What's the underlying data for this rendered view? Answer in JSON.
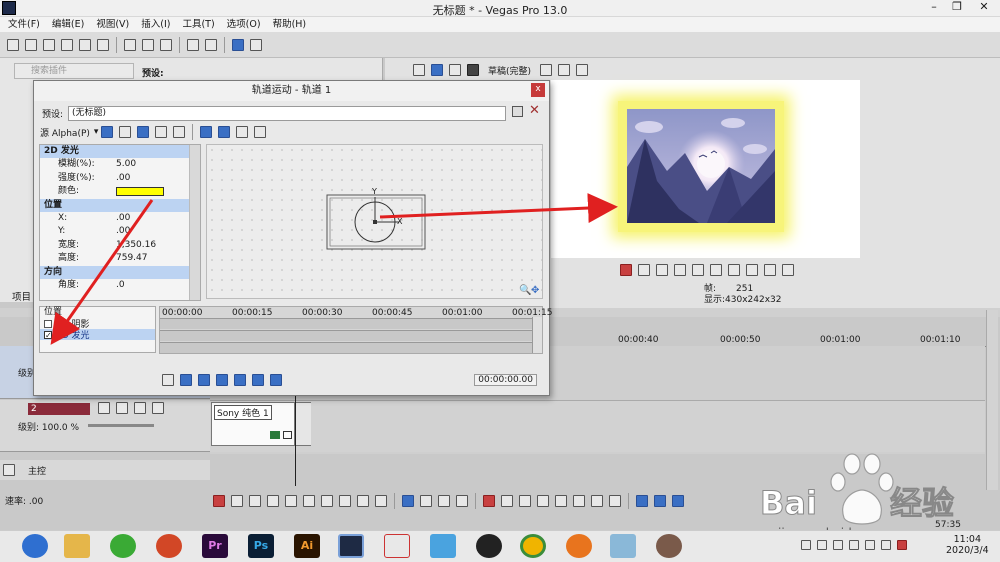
{
  "window": {
    "title": "无标题 * - Vegas Pro 13.0",
    "minimize": "–",
    "restore": "❐",
    "close": "✕"
  },
  "menu": [
    "文件(F)",
    "编辑(E)",
    "视图(V)",
    "插入(I)",
    "工具(T)",
    "选项(O)",
    "帮助(H)"
  ],
  "explorer": {
    "search_placeholder": "搜索插件",
    "preset_label": "预设:",
    "tab_label": "项目"
  },
  "preview": {
    "quality": "草稿(完整)",
    "frame_label": "帧:",
    "frame_value": "251",
    "display_label": "显示:",
    "display_value": "430x242x32"
  },
  "dialog": {
    "title": "轨道运动 - 轨道 1",
    "close": "x",
    "preset_label": "预设:",
    "preset_value": "(无标题)",
    "source_alpha": "源 Alpha(P)",
    "sections": {
      "glow": "2D 发光",
      "position": "位置",
      "orientation": "方向"
    },
    "params": {
      "blur_label": "模糊(%):",
      "blur_value": "5.00",
      "intensity_label": "强度(%):",
      "intensity_value": ".00",
      "color_label": "颜色:",
      "x_label": "X:",
      "x_value": ".00",
      "y_label": "Y:",
      "y_value": ".00",
      "width_label": "宽度:",
      "width_value": "1,350.16",
      "height_label": "高度:",
      "height_value": "759.47",
      "angle_label": "角度:",
      "angle_value": ".0"
    },
    "glow_color": "#ffff00",
    "timeline": {
      "ticks": [
        "00:00:00",
        "00:00:15",
        "00:00:30",
        "00:00:45",
        "00:01:00",
        "00:01:15"
      ],
      "list_header": "位置",
      "shadow_item": "2D 阴影",
      "glow_item": "2D 发光",
      "timecode": "00:00:00.00"
    },
    "canvas": {
      "y_axis": "Y",
      "x_axis": "X"
    }
  },
  "tracks": {
    "ruler": [
      "00:00:40",
      "00:00:50",
      "00:01:00",
      "00:01:10"
    ],
    "track1_level": "级别",
    "track2_number": "2",
    "track2_level": "级别: 100.0 %",
    "event_label": "Sony 纯色 1",
    "master_label": "主控",
    "rate": "速率: .00",
    "timecode": "57:35"
  },
  "watermark": {
    "text": "jingyan.baidu.com"
  },
  "taskbar": {
    "apps": [
      "Pr",
      "Ps",
      "Ai"
    ],
    "time": "11:04",
    "date": "2020/3/4"
  },
  "colors": {
    "accent": "#3a6fc4",
    "arrow": "#e02020",
    "section": "#bcd3f2"
  }
}
